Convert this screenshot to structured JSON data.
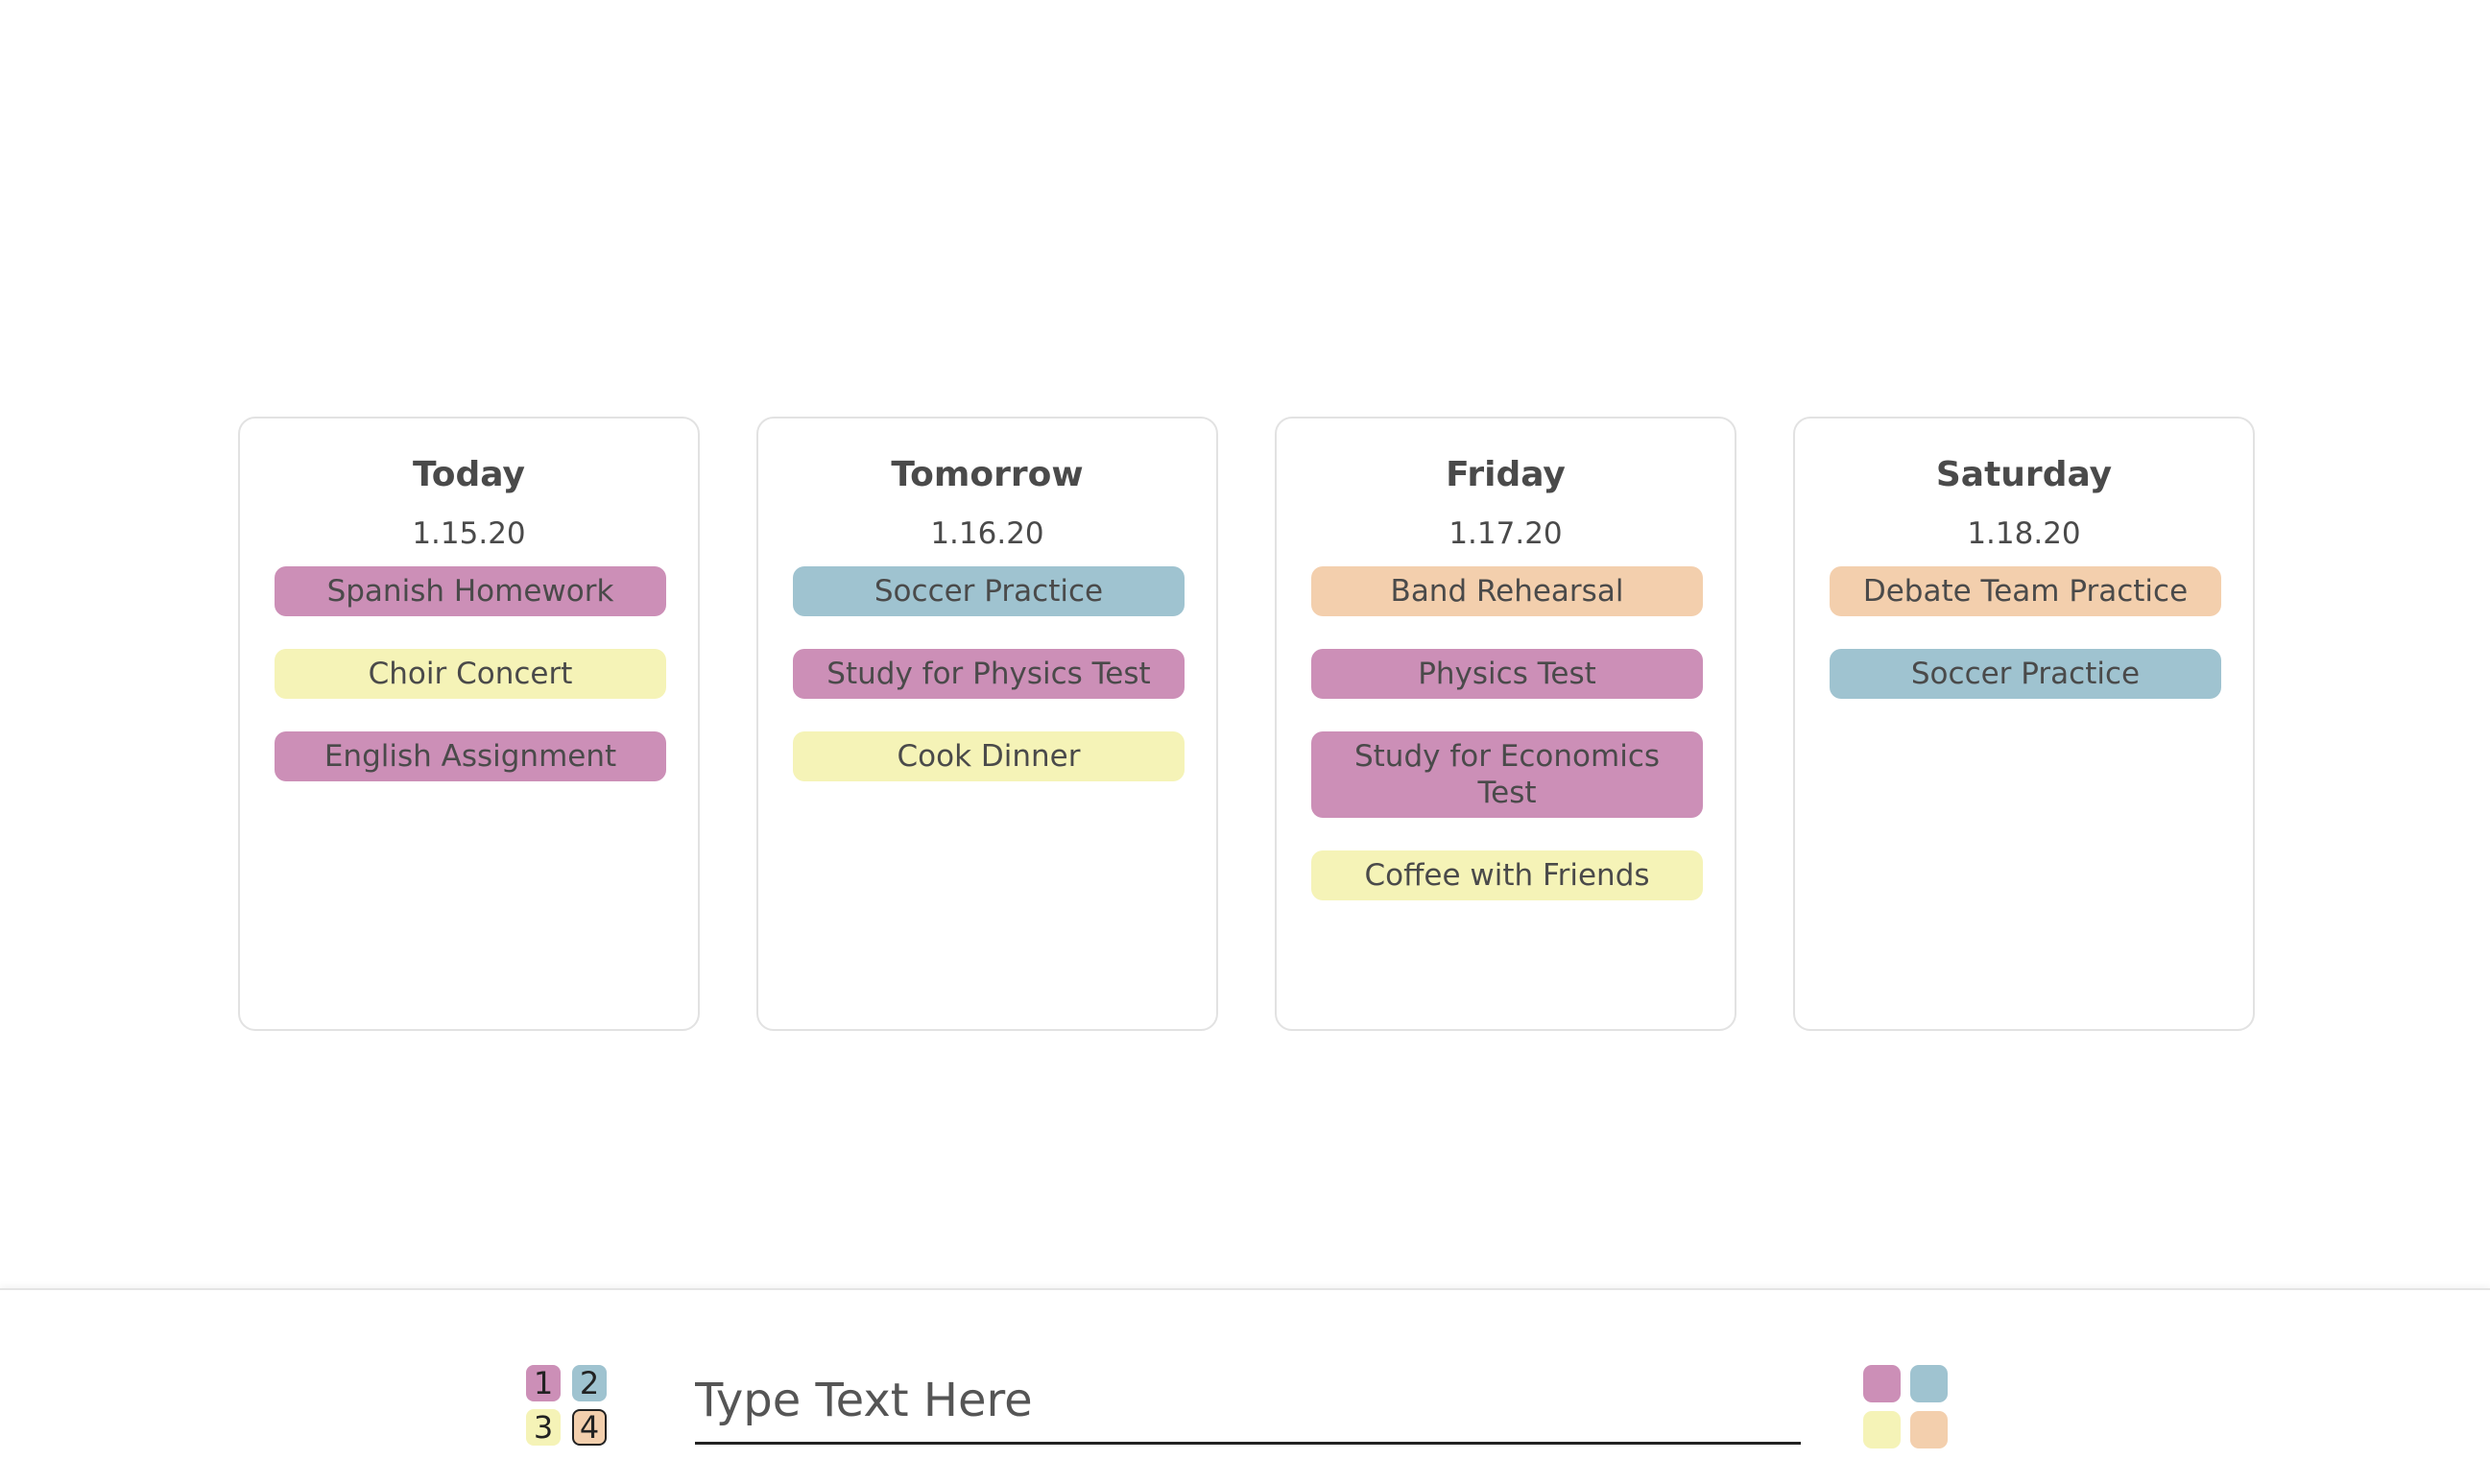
{
  "colors": {
    "category_1": "#cc8fb7",
    "category_2": "#9fc3d0",
    "category_3": "#f5f3b7",
    "category_4": "#f3cfad"
  },
  "columns": [
    {
      "day": "Today",
      "date": "1.15.20",
      "tasks": [
        {
          "label": "Spanish Homework",
          "color": "category_1"
        },
        {
          "label": "Choir Concert",
          "color": "category_3"
        },
        {
          "label": "English Assignment",
          "color": "category_1"
        }
      ]
    },
    {
      "day": "Tomorrow",
      "date": "1.16.20",
      "tasks": [
        {
          "label": "Soccer Practice",
          "color": "category_2"
        },
        {
          "label": "Study for Physics Test",
          "color": "category_1"
        },
        {
          "label": "Cook Dinner",
          "color": "category_3"
        }
      ]
    },
    {
      "day": "Friday",
      "date": "1.17.20",
      "tasks": [
        {
          "label": "Band Rehearsal",
          "color": "category_4"
        },
        {
          "label": "Physics Test",
          "color": "category_1"
        },
        {
          "label": "Study for Economics Test",
          "color": "category_1"
        },
        {
          "label": "Coffee with Friends",
          "color": "category_3"
        }
      ]
    },
    {
      "day": "Saturday",
      "date": "1.18.20",
      "tasks": [
        {
          "label": "Debate Team Practice",
          "color": "category_4"
        },
        {
          "label": "Soccer Practice",
          "color": "category_2"
        }
      ]
    }
  ],
  "input_bar": {
    "shortcut_keys": [
      "1",
      "2",
      "3",
      "4"
    ],
    "placeholder": "Type Text Here",
    "value": ""
  }
}
